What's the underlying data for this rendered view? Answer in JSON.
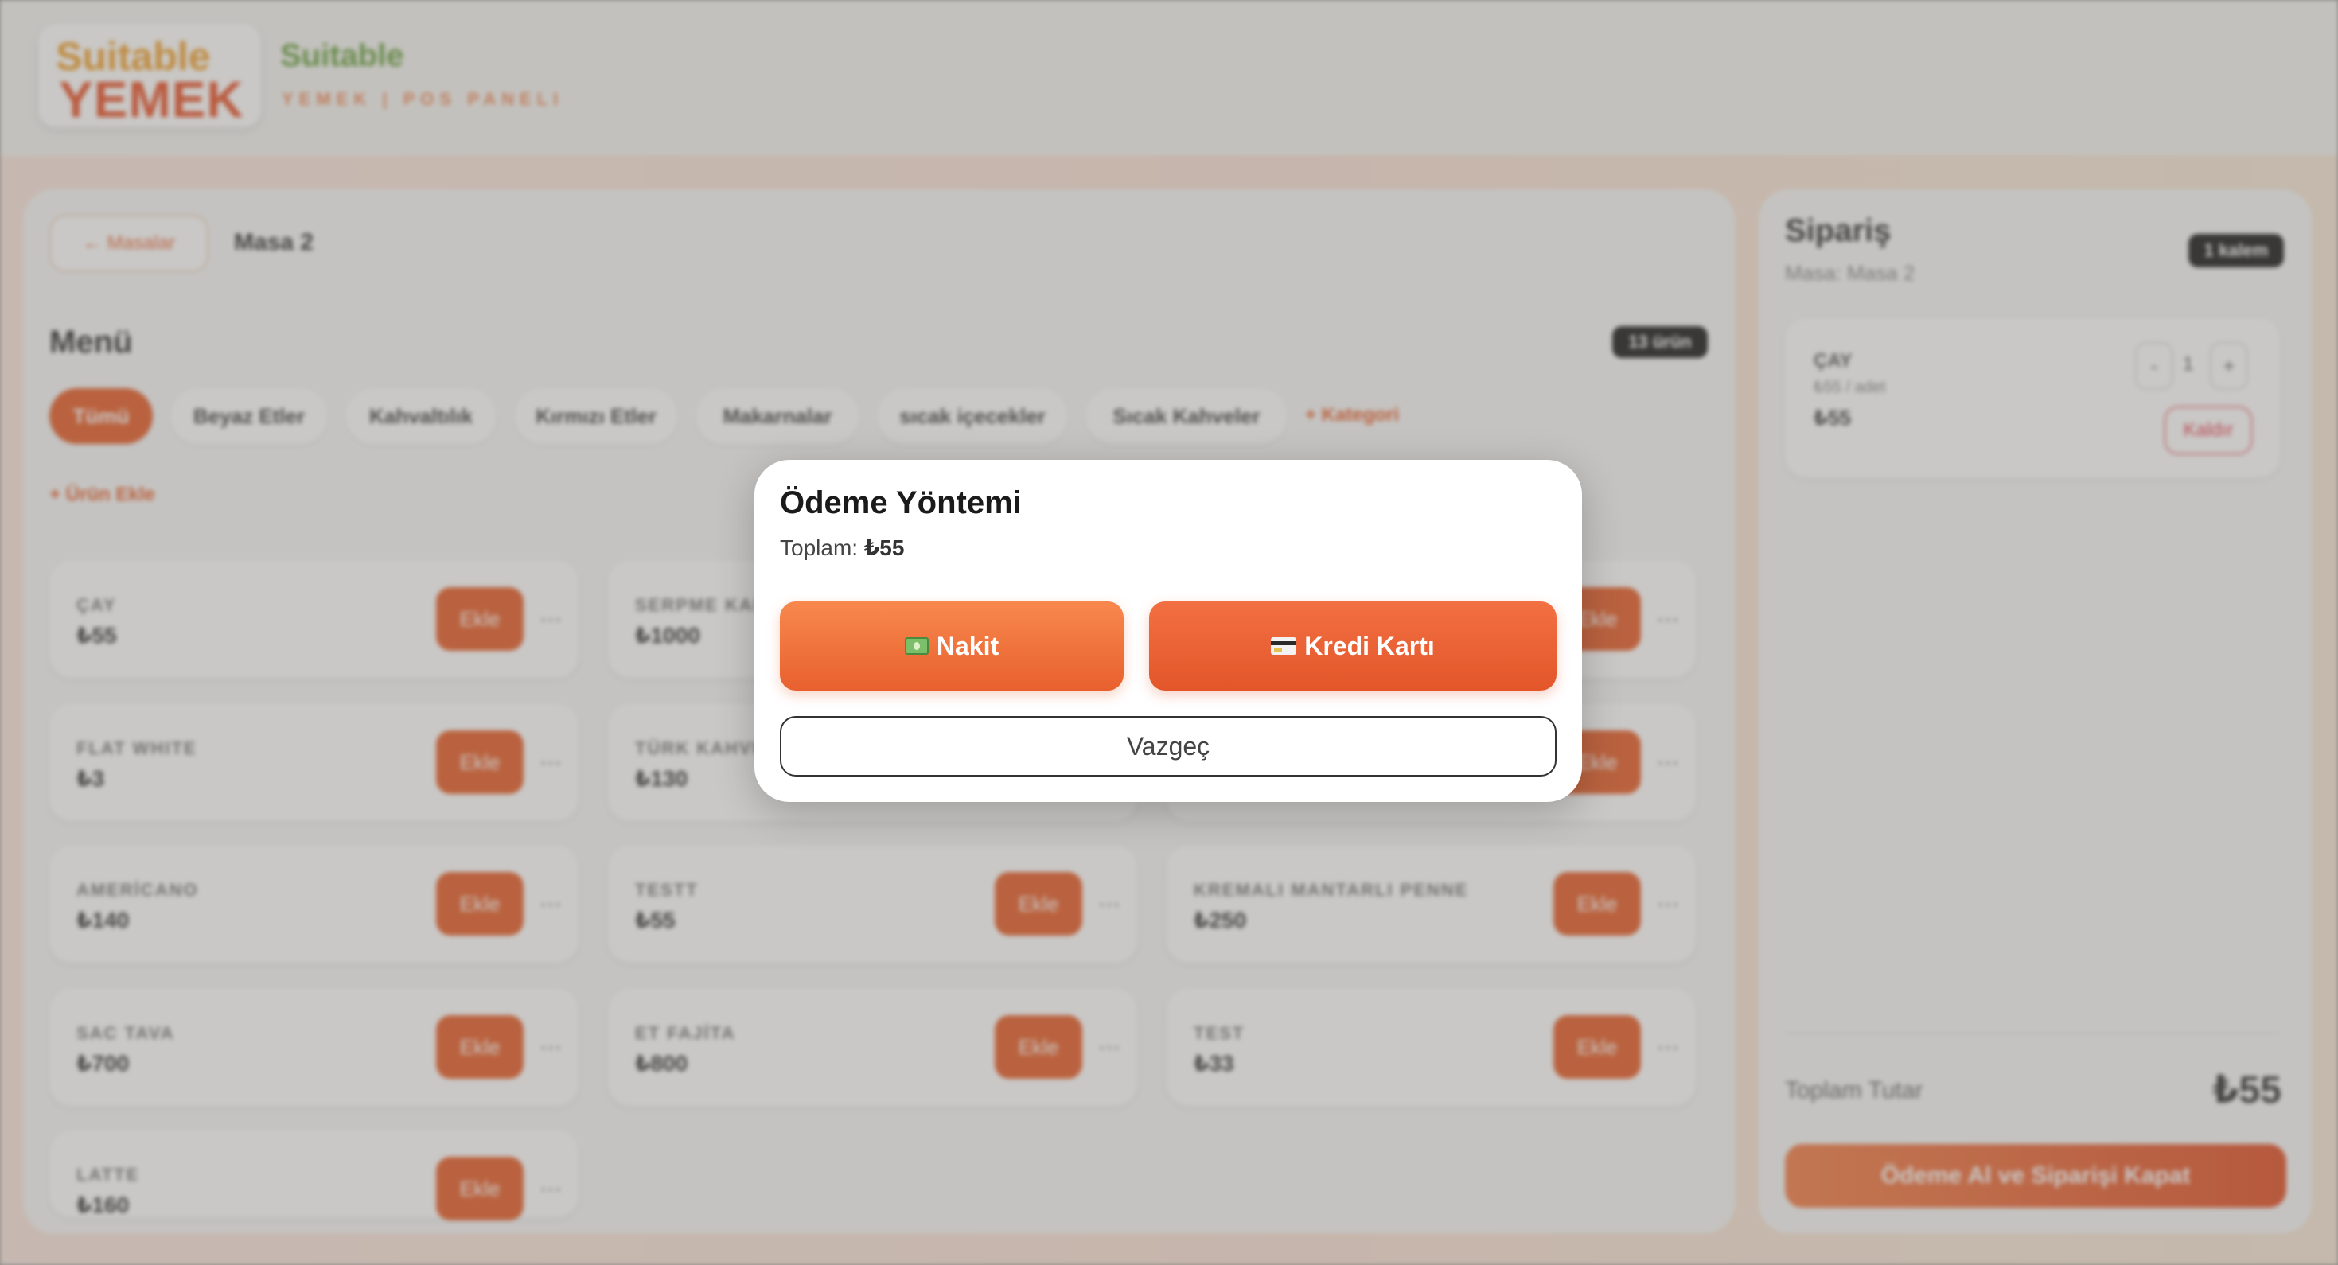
{
  "header": {
    "logo_top": "Suitable",
    "logo_main": "YEMEK",
    "brand_name": "Suitable",
    "brand_subtitle": "YEMEK | POS PANELI"
  },
  "menu_panel": {
    "back_label": "← Masalar",
    "table_name": "Masa 2",
    "title": "Menü",
    "count_badge": "13 ürün",
    "categories": [
      {
        "label": "Tümü",
        "active": true
      },
      {
        "label": "Beyaz Etler",
        "active": false
      },
      {
        "label": "Kahvaltılık",
        "active": false
      },
      {
        "label": "Kırmızı Etler",
        "active": false
      },
      {
        "label": "Makarnalar",
        "active": false
      },
      {
        "label": "sıcak içecekler",
        "active": false
      },
      {
        "label": "Sıcak Kahveler",
        "active": false
      }
    ],
    "add_category_label": "+ Kategori",
    "add_item_label": "+ Ürün Ekle",
    "add_button_label": "Ekle",
    "more_label": "⋯",
    "products": [
      {
        "name": "ÇAY",
        "price": "₺55"
      },
      {
        "name": "SERPME KAHVALTI",
        "price": "₺1000"
      },
      {
        "name": "FLAT WHITE",
        "price": "₺3"
      },
      {
        "name": "TÜRK KAHVESİ",
        "price": "₺130"
      },
      {
        "name": "AMERİCANO",
        "price": "₺140"
      },
      {
        "name": "TESTT",
        "price": "₺55"
      },
      {
        "name": "KREMALI MANTARLI PENNE",
        "price": "₺250"
      },
      {
        "name": "SAC TAVA",
        "price": "₺700"
      },
      {
        "name": "ET FAJİTA",
        "price": "₺800"
      },
      {
        "name": "TEST",
        "price": "₺33"
      },
      {
        "name": "LATTE",
        "price": "₺160"
      }
    ]
  },
  "order_panel": {
    "title": "Sipariş",
    "subtitle": "Masa: Masa 2",
    "items_badge": "1 kalem",
    "item": {
      "name": "ÇAY",
      "unit_price": "₺55 / adet",
      "line_total": "₺55",
      "qty": "1",
      "minus_label": "-",
      "plus_label": "+",
      "remove_label": "Kaldır"
    },
    "total_label": "Toplam Tutar",
    "total_value": "₺55",
    "pay_label": "Ödeme Al ve Siparişi Kapat"
  },
  "modal": {
    "title": "Ödeme Yöntemi",
    "total_label": "Toplam:",
    "total_amount": "₺55",
    "cash_label": "Nakit",
    "card_label": "Kredi Kartı",
    "cancel_label": "Vazgeç",
    "cash_icon": "banknote-icon",
    "card_icon": "credit-card-icon"
  },
  "colors": {
    "accent": "#e8602c",
    "overlay": "#9b9997",
    "text": "#1a1a1a"
  }
}
